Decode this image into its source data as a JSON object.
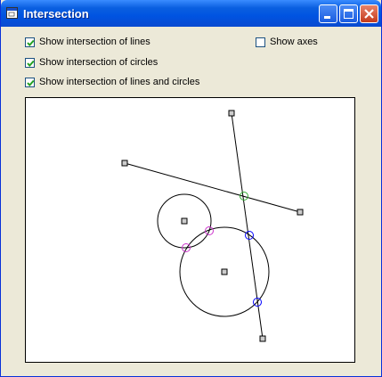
{
  "window": {
    "title": "Intersection"
  },
  "options": {
    "lines": {
      "label": "Show intersection of lines",
      "checked": true
    },
    "circles": {
      "label": "Show intersection of circles",
      "checked": true
    },
    "lines_circles": {
      "label": "Show intersection of lines and circles",
      "checked": true
    },
    "axes": {
      "label": "Show axes",
      "checked": false
    }
  },
  "colors": {
    "title_bar": "#0053e1",
    "lines_circles_intersection": "#0000ff",
    "circles_intersection": "#cc33cc",
    "lines_intersection": "#33aa33"
  },
  "icons": [
    "app-icon",
    "minimize-icon",
    "maximize-icon",
    "close-icon",
    "checkmark-icon"
  ]
}
